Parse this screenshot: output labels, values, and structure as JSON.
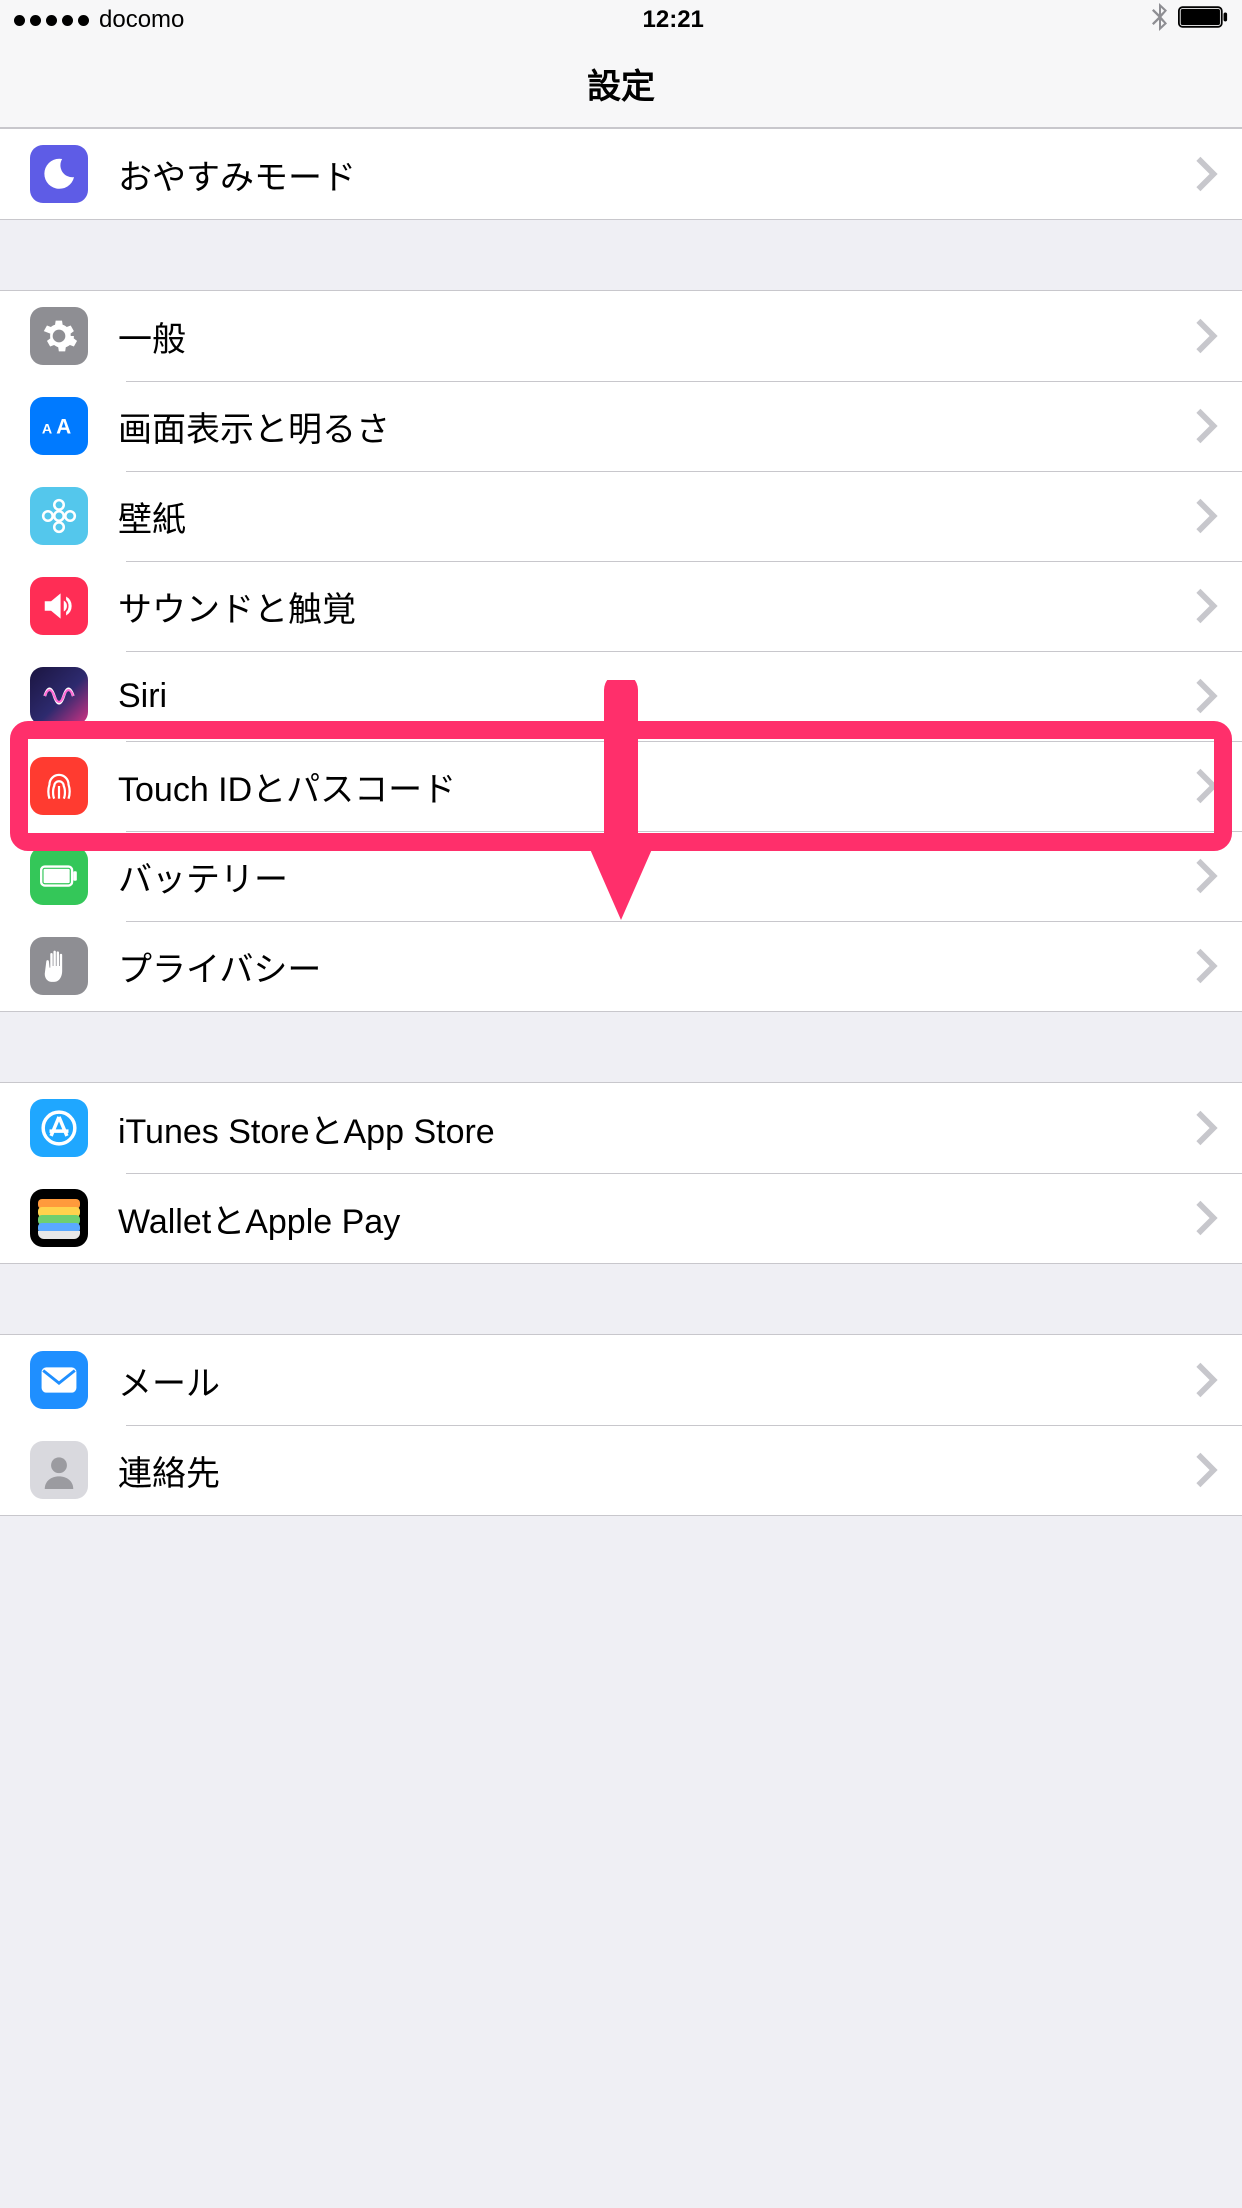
{
  "statusbar": {
    "carrier": "docomo",
    "time": "12:21"
  },
  "navbar": {
    "title": "設定"
  },
  "groups": [
    [
      {
        "id": "dnd",
        "label": "おやすみモード"
      }
    ],
    [
      {
        "id": "general",
        "label": "一般"
      },
      {
        "id": "display",
        "label": "画面表示と明るさ"
      },
      {
        "id": "wallpaper",
        "label": "壁紙"
      },
      {
        "id": "sound",
        "label": "サウンドと触覚"
      },
      {
        "id": "siri",
        "label": "Siri"
      },
      {
        "id": "touchid",
        "label": "Touch IDとパスコード"
      },
      {
        "id": "battery",
        "label": "バッテリー"
      },
      {
        "id": "privacy",
        "label": "プライバシー"
      }
    ],
    [
      {
        "id": "itunes",
        "label": "iTunes StoreとApp Store"
      },
      {
        "id": "wallet",
        "label": "WalletとApple Pay"
      }
    ],
    [
      {
        "id": "mail",
        "label": "メール"
      },
      {
        "id": "contacts",
        "label": "連絡先"
      }
    ]
  ],
  "annotation": {
    "highlight_row_id": "touchid",
    "arrow_target_id": "touchid",
    "color": "#ff2f6b"
  }
}
